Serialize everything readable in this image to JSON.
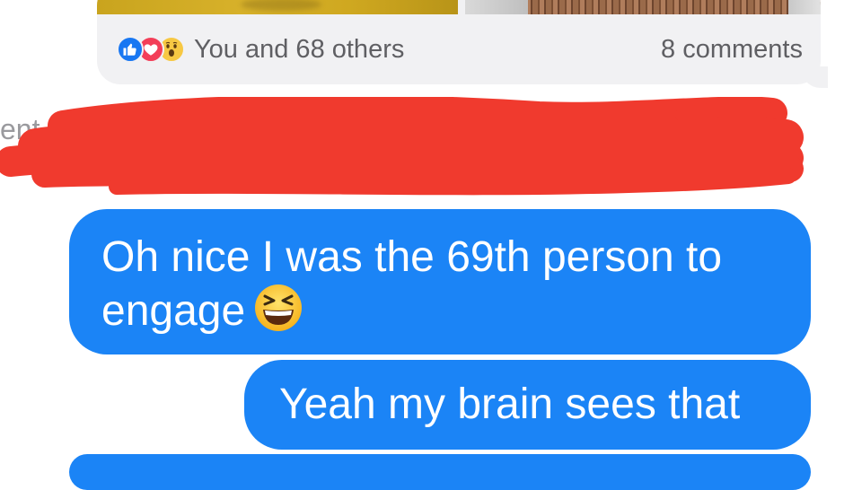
{
  "post": {
    "reaction_icons": [
      "like-icon",
      "love-icon",
      "wow-icon"
    ],
    "reaction_summary": "You and 68 others",
    "comment_count": "8 comments"
  },
  "hidden_message": {
    "visible_fragment": "ent a"
  },
  "messages": [
    {
      "text_line1": "Oh nice I was the 69th person to",
      "text_line2": "engage",
      "emoji": "grinning-squinting-face-icon"
    },
    {
      "text": "Yeah my brain sees that"
    }
  ],
  "colors": {
    "bubble_blue": "#1b84f6",
    "redaction_red": "#f03a2e",
    "post_background": "#f1f1f3",
    "like_blue": "#1877f2",
    "love_red": "#f33e58",
    "wow_yellow": "#f7c843"
  }
}
